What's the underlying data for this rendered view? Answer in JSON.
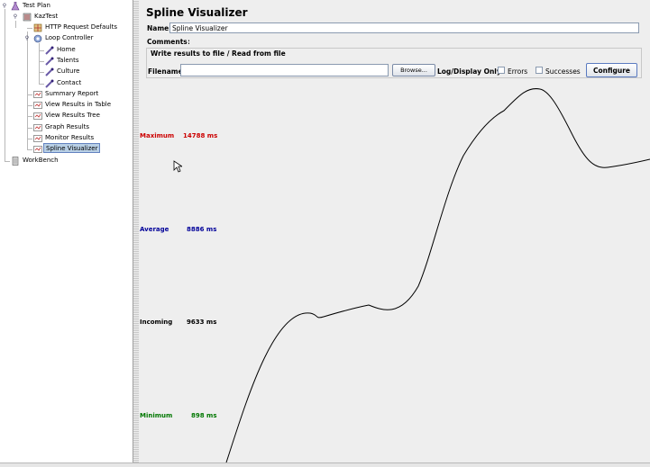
{
  "tree": {
    "test_plan": "Test Plan",
    "kaztest": "KazTest",
    "http_defaults": "HTTP Request Defaults",
    "loop_controller": "Loop Controller",
    "home": "Home",
    "talents": "Talents",
    "culture": "Culture",
    "contact": "Contact",
    "summary_report": "Summary Report",
    "view_results_table": "View Results in Table",
    "view_results_tree": "View Results Tree",
    "graph_results": "Graph Results",
    "monitor_results": "Monitor Results",
    "spline_visualizer": "Spline Visualizer",
    "workbench": "WorkBench"
  },
  "panel": {
    "title": "Spline Visualizer",
    "name_label": "Name:",
    "name_value": "Spline Visualizer",
    "comments_label": "Comments:",
    "comments_value": ""
  },
  "file": {
    "section_title": "Write results to file / Read from file",
    "filename_label": "Filename",
    "filename_value": "",
    "browse_label": "Browse...",
    "log_display_label": "Log/Display Only:",
    "errors_label": "Errors",
    "errors_checked": false,
    "successes_label": "Successes",
    "successes_checked": false,
    "configure_label": "Configure"
  },
  "stats": {
    "maximum_label": "Maximum",
    "maximum_value": "14788 ms",
    "average_label": "Average",
    "average_value": "8886 ms",
    "incoming_label": "Incoming",
    "incoming_value": "9633 ms",
    "minimum_label": "Minimum",
    "minimum_value": "898 ms"
  },
  "colors": {
    "maximum": "#cc0000",
    "average": "#000099",
    "incoming": "#000000",
    "minimum": "#007700",
    "selection": "#b8cfe5",
    "pane_bg": "#eeeeee"
  },
  "icons": {
    "test_plan": "flask-icon",
    "thread_group": "thread-group-icon",
    "config": "config-element-icon",
    "controller": "loop-controller-icon",
    "sampler": "pipette-icon",
    "listener": "listener-report-icon",
    "workbench": "workbench-icon"
  }
}
